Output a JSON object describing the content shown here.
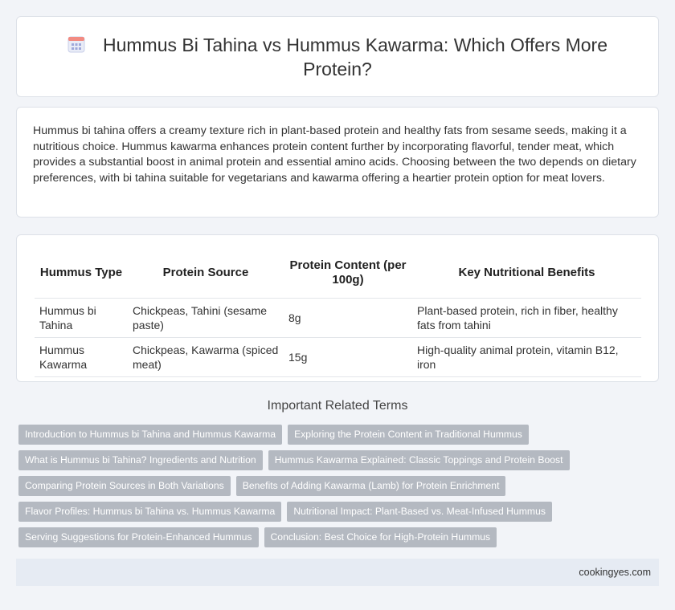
{
  "header": {
    "title": "Hummus Bi Tahina vs Hummus Kawarma: Which Offers More Protein?",
    "icon": "calendar-icon"
  },
  "intro": {
    "text": "Hummus bi tahina offers a creamy texture rich in plant-based protein and healthy fats from sesame seeds, making it a nutritious choice. Hummus kawarma enhances protein content further by incorporating flavorful, tender meat, which provides a substantial boost in animal protein and essential amino acids. Choosing between the two depends on dietary preferences, with bi tahina suitable for vegetarians and kawarma offering a heartier protein option for meat lovers."
  },
  "table": {
    "headers": [
      "Hummus Type",
      "Protein Source",
      "Protein Content (per 100g)",
      "Key Nutritional Benefits"
    ],
    "rows": [
      [
        "Hummus bi Tahina",
        "Chickpeas, Tahini (sesame paste)",
        "8g",
        "Plant-based protein, rich in fiber, healthy fats from tahini"
      ],
      [
        "Hummus Kawarma",
        "Chickpeas, Kawarma (spiced meat)",
        "15g",
        "High-quality animal protein, vitamin B12, iron"
      ]
    ]
  },
  "related": {
    "title": "Important Related Terms",
    "tags": [
      "Introduction to Hummus bi Tahina and Hummus Kawarma",
      "Exploring the Protein Content in Traditional Hummus",
      "What is Hummus bi Tahina? Ingredients and Nutrition",
      "Hummus Kawarma Explained: Classic Toppings and Protein Boost",
      "Comparing Protein Sources in Both Variations",
      "Benefits of Adding Kawarma (Lamb) for Protein Enrichment",
      "Flavor Profiles: Hummus bi Tahina vs. Hummus Kawarma",
      "Nutritional Impact: Plant-Based vs. Meat-Infused Hummus",
      "Serving Suggestions for Protein-Enhanced Hummus",
      "Conclusion: Best Choice for High-Protein Hummus"
    ]
  },
  "footer": {
    "site": "cookingyes.com"
  }
}
